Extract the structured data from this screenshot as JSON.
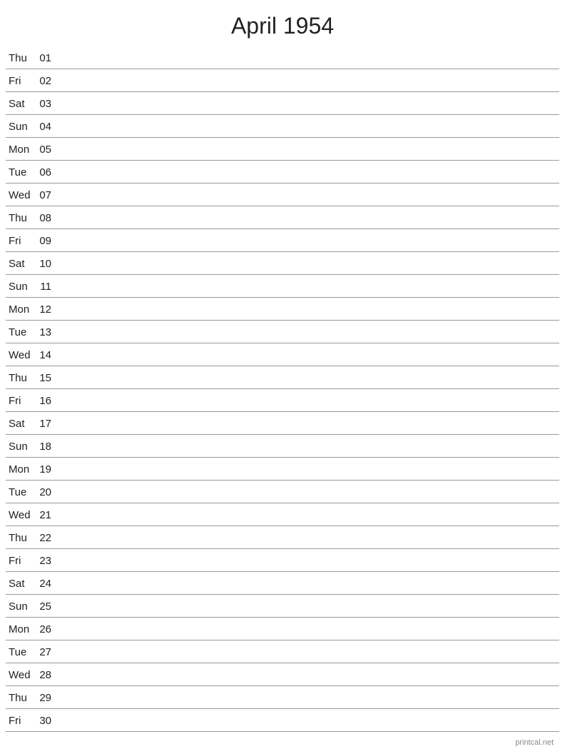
{
  "title": "April 1954",
  "footer": "printcal.net",
  "days": [
    {
      "name": "Thu",
      "number": "01"
    },
    {
      "name": "Fri",
      "number": "02"
    },
    {
      "name": "Sat",
      "number": "03"
    },
    {
      "name": "Sun",
      "number": "04"
    },
    {
      "name": "Mon",
      "number": "05"
    },
    {
      "name": "Tue",
      "number": "06"
    },
    {
      "name": "Wed",
      "number": "07"
    },
    {
      "name": "Thu",
      "number": "08"
    },
    {
      "name": "Fri",
      "number": "09"
    },
    {
      "name": "Sat",
      "number": "10"
    },
    {
      "name": "Sun",
      "number": "11"
    },
    {
      "name": "Mon",
      "number": "12"
    },
    {
      "name": "Tue",
      "number": "13"
    },
    {
      "name": "Wed",
      "number": "14"
    },
    {
      "name": "Thu",
      "number": "15"
    },
    {
      "name": "Fri",
      "number": "16"
    },
    {
      "name": "Sat",
      "number": "17"
    },
    {
      "name": "Sun",
      "number": "18"
    },
    {
      "name": "Mon",
      "number": "19"
    },
    {
      "name": "Tue",
      "number": "20"
    },
    {
      "name": "Wed",
      "number": "21"
    },
    {
      "name": "Thu",
      "number": "22"
    },
    {
      "name": "Fri",
      "number": "23"
    },
    {
      "name": "Sat",
      "number": "24"
    },
    {
      "name": "Sun",
      "number": "25"
    },
    {
      "name": "Mon",
      "number": "26"
    },
    {
      "name": "Tue",
      "number": "27"
    },
    {
      "name": "Wed",
      "number": "28"
    },
    {
      "name": "Thu",
      "number": "29"
    },
    {
      "name": "Fri",
      "number": "30"
    }
  ]
}
